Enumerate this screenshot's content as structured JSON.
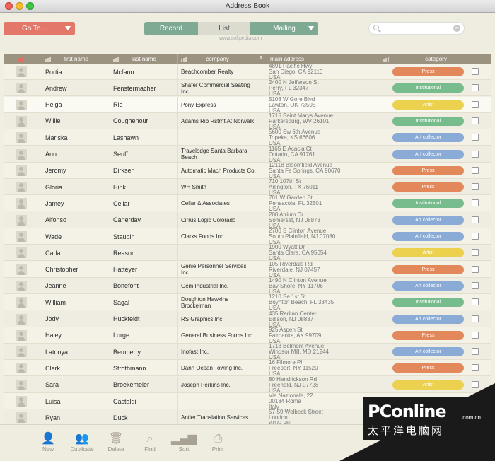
{
  "window": {
    "title": "Address Book"
  },
  "toolbar": {
    "goto_label": "Go To ...",
    "view_record": "Record",
    "view_list": "List",
    "view_mailing": "Mailing",
    "watermark": "www.softpedia.com",
    "search_placeholder": ""
  },
  "columns": {
    "photo": "",
    "first_name": "first name",
    "last_name": "last name",
    "company": "company",
    "address": "main address",
    "category": "category"
  },
  "category_colors": {
    "Press": "#e3885b",
    "Institutional": "#76bc8d",
    "Artist": "#ecd14e",
    "Art collector": "#8aabd6"
  },
  "contacts": [
    {
      "first": "Portia",
      "last": "Mcfann",
      "company": "Beachcomber Realty",
      "addr1": "4891 Pacific Hwy",
      "addr2": "San Diego, CA 92110",
      "addr3": "USA",
      "category": "Press"
    },
    {
      "first": "Andrew",
      "last": "Fenstermacher",
      "company": "Shafer Commercial Seating Inc.",
      "addr1": "2400 N Jefferson St",
      "addr2": "Perry, FL 32347",
      "addr3": "USA",
      "category": "Institutional"
    },
    {
      "first": "Helga",
      "last": "Rio",
      "company": "Pony Express",
      "addr1": "5108 W Gore Blvd",
      "addr2": "Lawton, OK 73505",
      "addr3": "USA",
      "category": "Artist"
    },
    {
      "first": "Willie",
      "last": "Coughenour",
      "company": "Adams Rib Rstrnt At Norwalk",
      "addr1": "1715 Saint Marys Avenue",
      "addr2": "Parkersburg, WV 26101",
      "addr3": "USA",
      "category": "Institutional"
    },
    {
      "first": "Mariska",
      "last": "Lashawn",
      "company": "",
      "addr1": "5600 Sw 6th Avenue",
      "addr2": "Topeka, KS 66606",
      "addr3": "USA",
      "category": "Art collector"
    },
    {
      "first": "Ann",
      "last": "Senff",
      "company": "Travelodge Santa Barbara Beach",
      "addr1": "1165 E Acacia Ct",
      "addr2": "Ontario, CA 91761",
      "addr3": "USA",
      "category": "Art collector"
    },
    {
      "first": "Jeromy",
      "last": "Dirksen",
      "company": "Automatic Mach Products Co.",
      "addr1": "12118 Bloomfield Avenue",
      "addr2": "Santa Fe Springs, CA 90670",
      "addr3": "USA",
      "category": "Press"
    },
    {
      "first": "Gloria",
      "last": "Hink",
      "company": "WH Smith",
      "addr1": "710 107th St",
      "addr2": "Arlington, TX 76011",
      "addr3": "USA",
      "category": "Press"
    },
    {
      "first": "Jamey",
      "last": "Cellar",
      "company": "Cellar & Associates",
      "addr1": "701 W Garden St",
      "addr2": "Pensacola, FL 32501",
      "addr3": "USA",
      "category": "Institutional"
    },
    {
      "first": "Alfonso",
      "last": "Canerday",
      "company": "Cirrus Logic Colorado",
      "addr1": "200 Atrium Dr",
      "addr2": "Somerset, NJ 08873",
      "addr3": "USA",
      "category": "Art collector"
    },
    {
      "first": "Wade",
      "last": "Staubin",
      "company": "Clarks Foods Inc.",
      "addr1": "2700 S Clinton Avenue",
      "addr2": "South Plainfield, NJ 07080",
      "addr3": "USA",
      "category": "Art collector"
    },
    {
      "first": "Carla",
      "last": "Reasor",
      "company": "",
      "addr1": "1900 Wyatt Dr",
      "addr2": "Santa Clara, CA 95054",
      "addr3": "USA",
      "category": "Artist"
    },
    {
      "first": "Christopher",
      "last": "Hatteyer",
      "company": "Genie Personnel Services Inc.",
      "addr1": "105 Riverdale Rd",
      "addr2": "Riverdale, NJ 07457",
      "addr3": "USA",
      "category": "Press"
    },
    {
      "first": "Jeanne",
      "last": "Bonefont",
      "company": "Gem Industrial Inc.",
      "addr1": "1490 N Clinton Avenue",
      "addr2": "Bay Shore, NY 11706",
      "addr3": "USA",
      "category": "Art collector"
    },
    {
      "first": "William",
      "last": "Sagal",
      "company": "Doughton Hawkins Brockelman",
      "addr1": "1210 Se 1st St",
      "addr2": "Boynton Beach, FL 33435",
      "addr3": "USA",
      "category": "Institutional"
    },
    {
      "first": "Jody",
      "last": "Huckfeldt",
      "company": "RS Graphics Inc.",
      "addr1": "435 Raritan Center",
      "addr2": "Edison, NJ 08837",
      "addr3": "USA",
      "category": "Art collector"
    },
    {
      "first": "Haley",
      "last": "Lorge",
      "company": "General Business Forms Inc.",
      "addr1": "925 Aspen St",
      "addr2": "Fairbanks, AK 99709",
      "addr3": "USA",
      "category": "Press"
    },
    {
      "first": "Latonya",
      "last": "Bemberry",
      "company": "Inofast Inc.",
      "addr1": "1718 Belmont Avenue",
      "addr2": "Windsor Mill, MD 21244",
      "addr3": "USA",
      "category": "Art collector"
    },
    {
      "first": "Clark",
      "last": "Strothmann",
      "company": "Dann Ocean Towing Inc.",
      "addr1": "16 Filmore Pl",
      "addr2": "Freeport, NY 11520",
      "addr3": "USA",
      "category": "Press"
    },
    {
      "first": "Sara",
      "last": "Broekemeier",
      "company": "Joseph Perkins Inc.",
      "addr1": "80 Hendrickson Rd",
      "addr2": "Freehold, NJ 07728",
      "addr3": "USA",
      "category": "Artist"
    },
    {
      "first": "Luisa",
      "last": "Castaldi",
      "company": "",
      "addr1": "Via Nazionale, 22",
      "addr2": "00184 Roma",
      "addr3": "Italy",
      "category": ""
    },
    {
      "first": "Ryan",
      "last": "Duck",
      "company": "Antler Translation Services",
      "addr1": "57-59 Welbeck Street",
      "addr2": "London",
      "addr3": "W1G 9BL",
      "category": ""
    }
  ],
  "bottom_toolbar": {
    "new": "New",
    "duplicate": "Duplicate",
    "delete": "Delete",
    "find": "Find",
    "sort": "Sort",
    "print": "Print"
  },
  "overlay": {
    "brand": "PConline",
    "domain_suffix": ".com.cn",
    "chinese": "太平洋电脑网"
  }
}
